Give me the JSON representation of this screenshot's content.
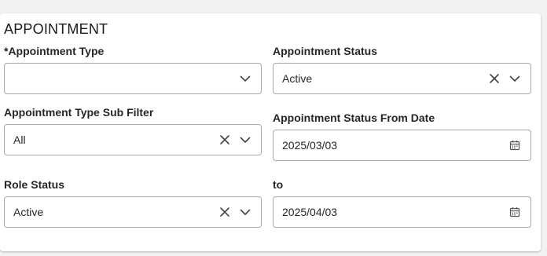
{
  "section": {
    "title": "APPOINTMENT"
  },
  "fields": {
    "appointment_type": {
      "label": "*Appointment Type",
      "value": ""
    },
    "appointment_status": {
      "label": "Appointment Status",
      "value": "Active"
    },
    "appointment_type_sub_filter": {
      "label": "Appointment Type Sub Filter",
      "value": "All"
    },
    "appointment_status_from_date": {
      "label": "Appointment Status From Date",
      "value": "2025/03/03"
    },
    "role_status": {
      "label": "Role Status",
      "value": "Active"
    },
    "to_date": {
      "label": "to",
      "value": "2025/04/03"
    }
  },
  "icons": {
    "clear": "close-icon",
    "dropdown": "chevron-down-icon",
    "date": "calendar-icon"
  }
}
